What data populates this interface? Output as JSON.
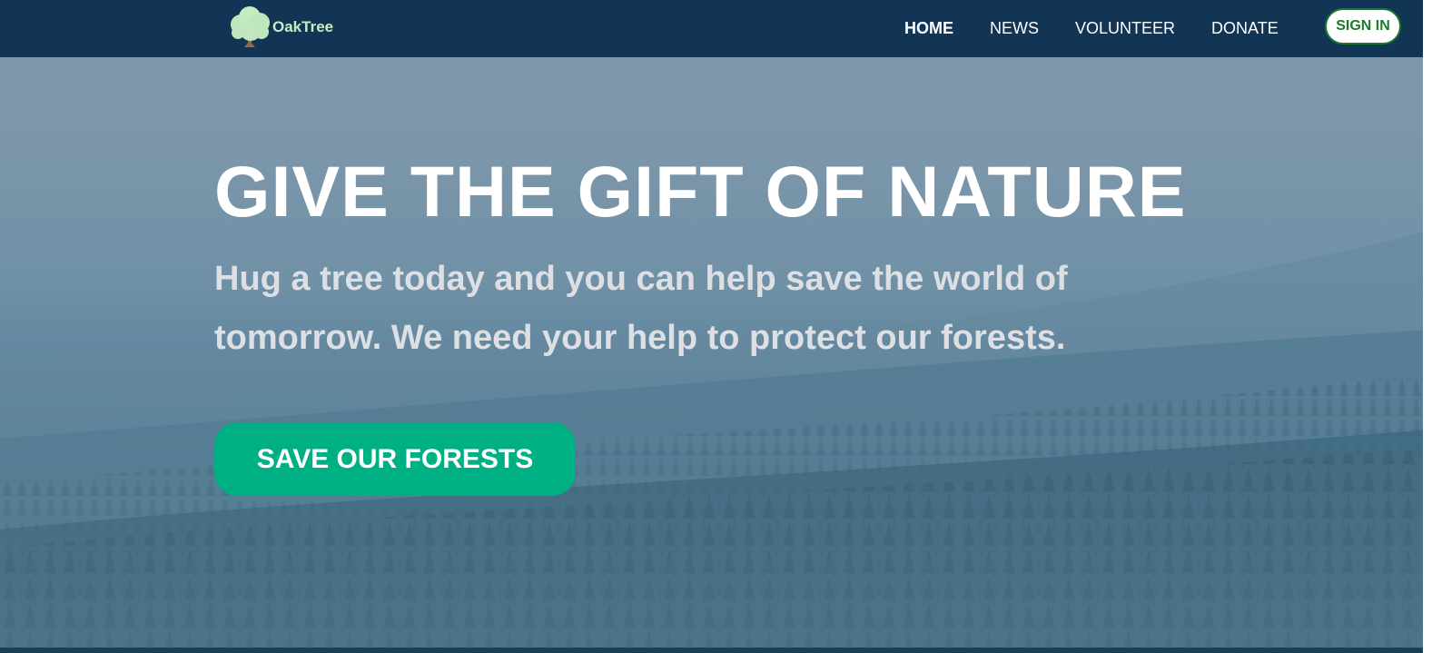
{
  "brand": {
    "name": "OakTree",
    "logo_icon": "oak-tree-icon"
  },
  "nav": {
    "links": [
      {
        "label": "HOME",
        "active": true
      },
      {
        "label": "NEWS",
        "active": false
      },
      {
        "label": "VOLUNTEER",
        "active": false
      },
      {
        "label": "DONATE",
        "active": false
      }
    ],
    "signin_label": "SIGN IN"
  },
  "hero": {
    "headline": "GIVE THE GIFT OF NATURE",
    "subtitle": "Hug a tree today and you can help save the world of tomorrow. We need your help to protect our forests.",
    "cta_label": "SAVE OUR FORESTS",
    "background": "misty-forest-aerial"
  },
  "colors": {
    "navbar": "#133555",
    "logo_text": "#c9ecc7",
    "signin_text": "#1b7a2c",
    "cta": "#00b085",
    "headline": "#ffffff",
    "subtitle": "#dcdfe3"
  }
}
